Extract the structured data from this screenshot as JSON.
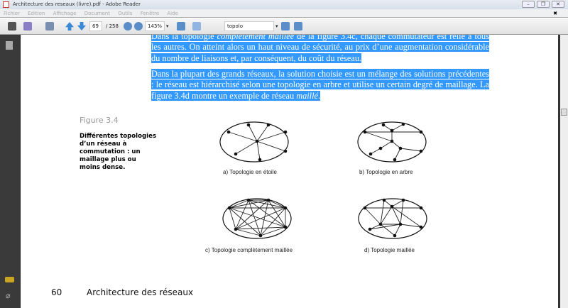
{
  "window": {
    "title": "Architecture des reseaux (livre).pdf - Adobe Reader",
    "controls": [
      "minimize",
      "restore",
      "close"
    ]
  },
  "menu": [
    "Fichier",
    "Edition",
    "Affichage",
    "Document",
    "Outils",
    "Fenêtre",
    "Aide"
  ],
  "toolbar": {
    "page_current": "69",
    "page_total": "/ 258",
    "zoom": "143%",
    "search_value": "topolo"
  },
  "document": {
    "paragraph1": {
      "before": "Dans la topologie ",
      "italic": "complètement maillée",
      "after": " de la figure 3.4c, chaque commutateur est relié à tous les autres. On atteint alors un haut niveau de sécurité, au prix d’une augmentation considérable du nombre de liaisons et, par conséquent, du coût du réseau."
    },
    "paragraph2": {
      "before": "Dans la plupart des grands réseaux, la solution choisie est un mélange des solutions précédentes : le réseau est hiérarchisé selon une topologie en arbre et utilise un certain degré de maillage. La figure 3.4d montre un exemple de réseau ",
      "italic": "maillé",
      "after": "."
    },
    "selection_color": "#3399ff",
    "figure_label": "Figure 3.4",
    "figure_caption": "Différentes topologies d’un réseau à commutation : un maillage plus ou moins dense.",
    "diagrams": [
      {
        "caption": "a) Topologie en étoile"
      },
      {
        "caption": "b) Topologie en arbre"
      },
      {
        "caption": "c) Topologie complètement maillée"
      },
      {
        "caption": "d) Topologie maillée"
      }
    ],
    "page_number": "60",
    "running_title": "Architecture des réseaux"
  },
  "left_panel": {
    "icons": [
      "pages-icon",
      "comments-icon",
      "attachment-icon"
    ]
  }
}
